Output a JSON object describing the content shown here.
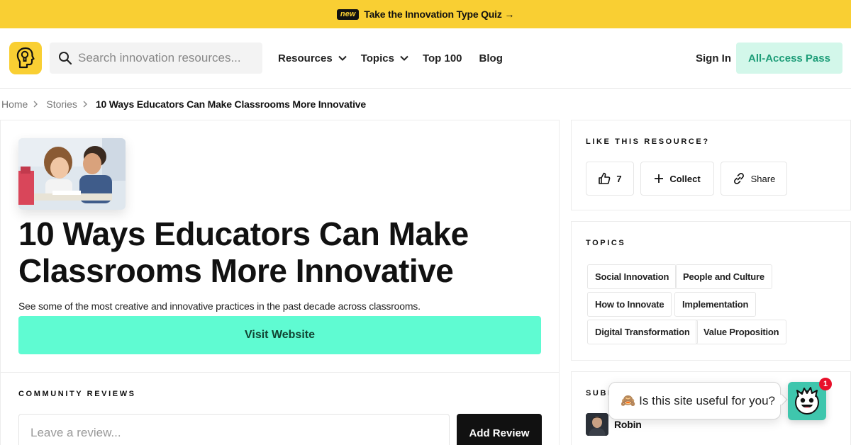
{
  "promo": {
    "badge": "new",
    "link": "Take the Innovation Type Quiz →",
    "bg_color": "#f9cf33"
  },
  "header": {
    "logo_icon": "lightbulb-head-icon",
    "search": {
      "placeholder": "Search innovation resources..."
    },
    "nav": {
      "resources": "Resources",
      "topics": "Topics",
      "top100": "Top 100",
      "blog": "Blog"
    },
    "sign_in": "Sign In",
    "all_access": "All-Access Pass"
  },
  "breadcrumb": [
    "Home",
    "Stories",
    "10 Ways Educators Can Make Classrooms More Innovative"
  ],
  "resource": {
    "title": "10 Ways Educators Can Make Classrooms More Innovative",
    "description": "See some of the most creative and innovative practices in the past decade across classrooms.",
    "visit_label": "Visit Website",
    "accent_color": "#5ffbd2"
  },
  "reviews": {
    "label": "COMMUNITY REVIEWS",
    "placeholder": "Leave a review...",
    "add_label": "Add Review"
  },
  "like": {
    "label": "LIKE THIS RESOURCE?",
    "likes_count": "7",
    "collect_label": "Collect",
    "share_label": "Share"
  },
  "topics": {
    "label": "TOPICS",
    "tags": [
      "Social Innovation",
      "People and Culture",
      "How to Innovate",
      "Implementation",
      "Digital Transformation",
      "Value Proposition"
    ]
  },
  "submitted": {
    "label": "SUBM",
    "name": "Robin"
  },
  "chat": {
    "emoji": "🙈",
    "question": "Is this site useful for you?",
    "badge_count": "1"
  }
}
